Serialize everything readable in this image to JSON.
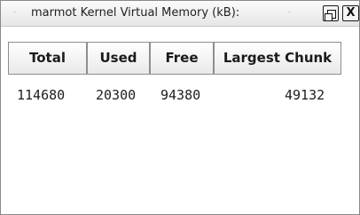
{
  "window": {
    "title": "marmot Kernel Virtual Memory (kB):",
    "buttons": {
      "restore_icon": "restore-icon",
      "close_label": "X"
    }
  },
  "table": {
    "columns": [
      "Total",
      "Used",
      "Free",
      "Largest Chunk"
    ],
    "rows": [
      [
        "114680",
        "20300",
        "94380",
        "49132"
      ]
    ]
  }
}
